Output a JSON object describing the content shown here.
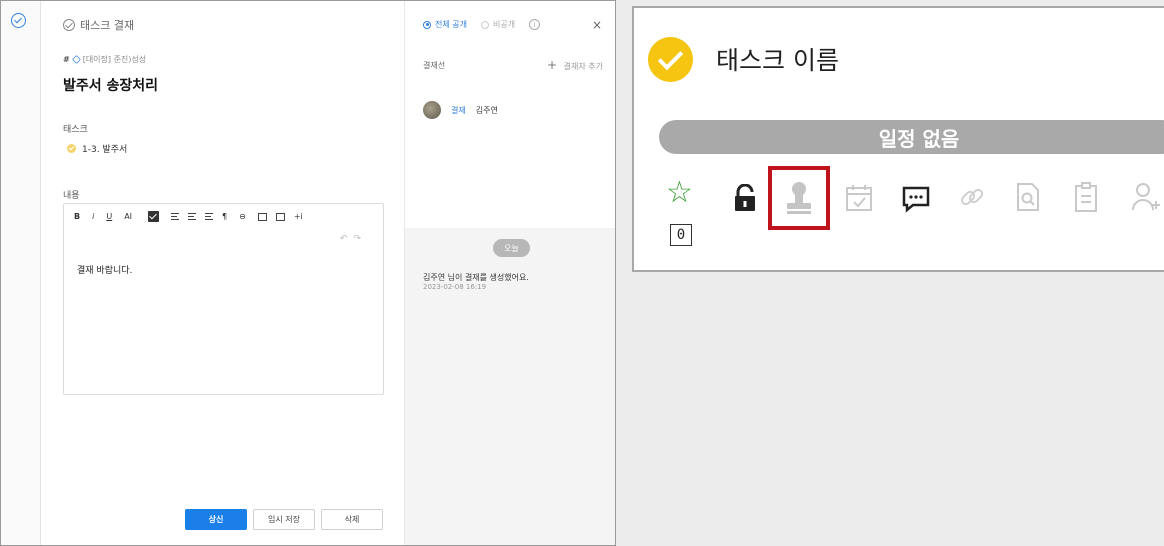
{
  "left_form": {
    "header_title": "태스크 결재",
    "project_tag": "[대이정] 준진)성성",
    "title": "발주서 송장처리",
    "task_label": "태스크",
    "task_item": "1-3. 발주서",
    "content_label": "내용",
    "toolbar": {
      "bold": "B",
      "italic": "i",
      "underline": "U",
      "font_size": "AI",
      "paragraph": "¶",
      "link": "⊖",
      "add": "+i",
      "undo_redo": "↶↷"
    },
    "body_text": "결재 바랍니다.",
    "buttons": {
      "submit": "상신",
      "draft": "임시 저장",
      "delete": "삭제"
    }
  },
  "side": {
    "public_label": "전체 공개",
    "private_label": "비공개",
    "info_icon_text": "i",
    "close_label": "×",
    "line_label": "결재선",
    "add_approver_label": "결재자 추가",
    "approver": {
      "role": "결재",
      "name": "김주연"
    },
    "today_label": "오늘",
    "activity": {
      "text": "김주연 님이 결재를 생성했어요.",
      "time": "2023-02-08 16:19"
    }
  },
  "card": {
    "title": "태스크 이름",
    "schedule": "일정 없음",
    "star_count": "0",
    "icons": [
      "star-icon",
      "lock-icon",
      "stamp-icon",
      "calendar-icon",
      "comment-icon",
      "link-icon",
      "file-search-icon",
      "memo-icon",
      "add-person-icon"
    ]
  },
  "colors": {
    "accent": "#1a7fe8",
    "check_yellow": "#f5c511",
    "star_green": "#3a9f34",
    "highlight_red": "#c0131b"
  }
}
